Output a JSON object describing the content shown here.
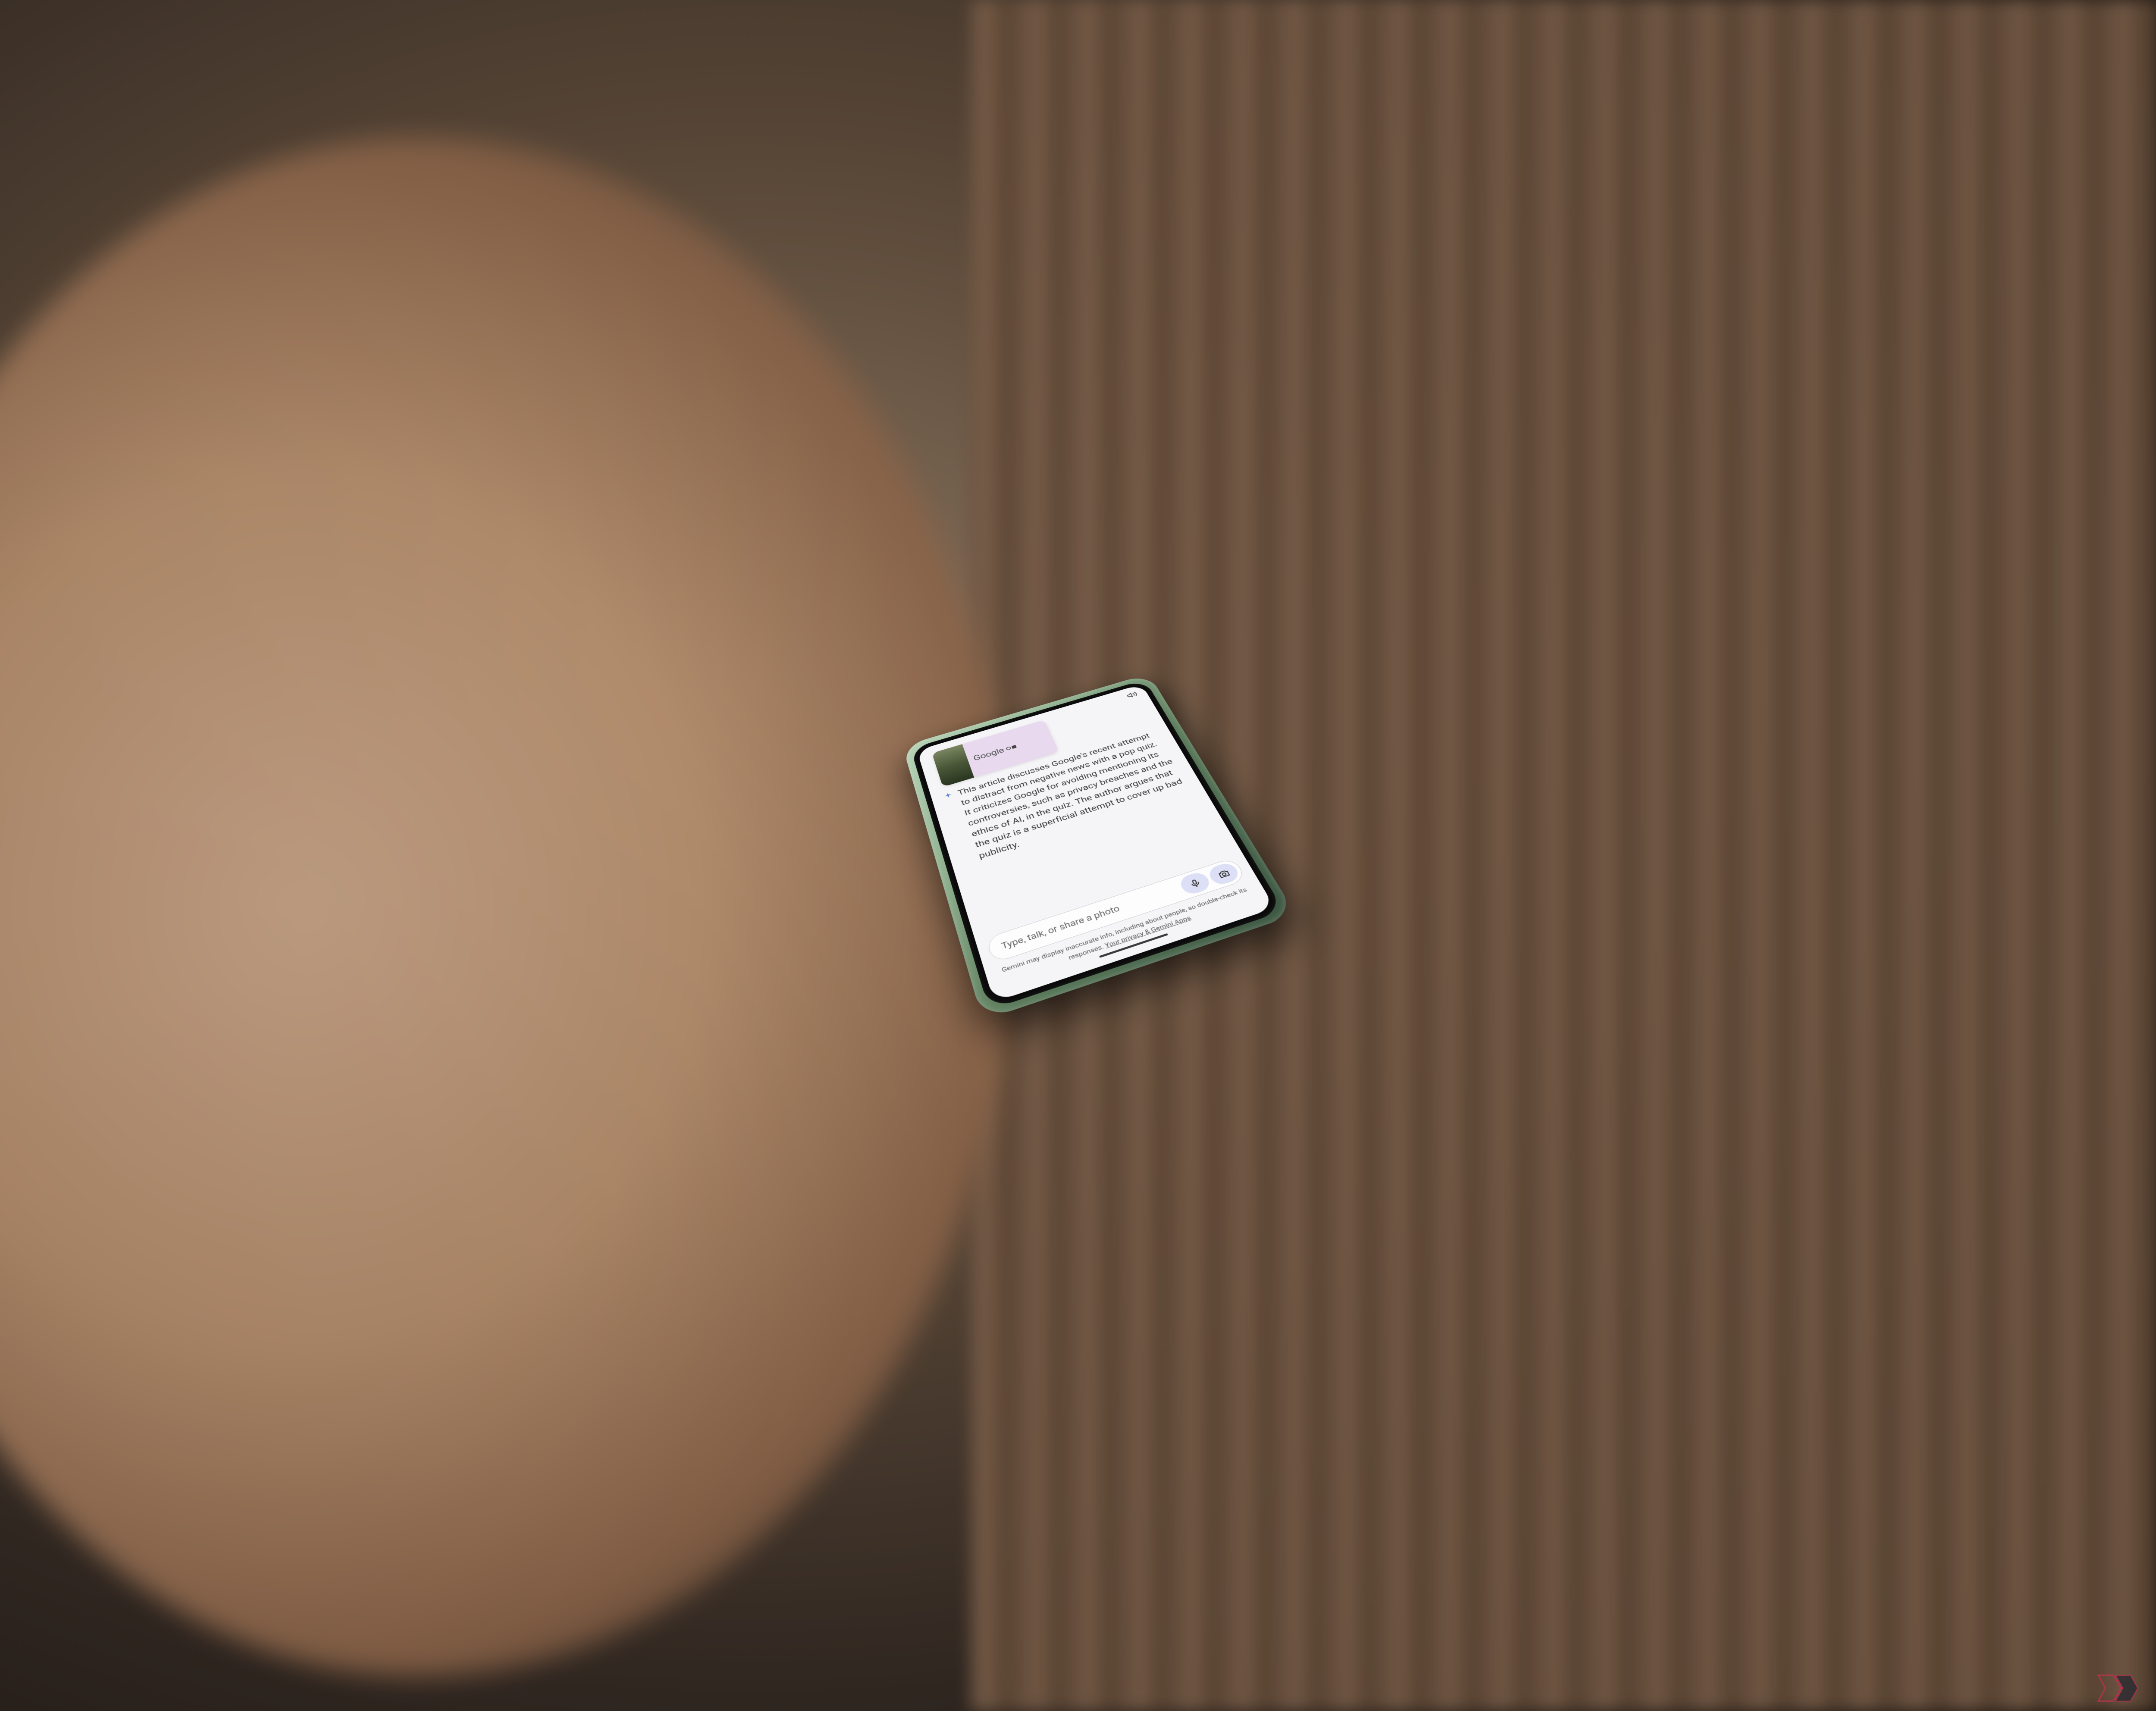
{
  "card": {
    "logo_text": "Google"
  },
  "response": {
    "text": "This article discusses Google's recent attempt to distract from negative news with a pop quiz. It criticizes Google for avoiding mentioning its controversies, such as privacy breaches and the ethics of AI, in the quiz. The author argues that the quiz is a superficial attempt to cover up bad publicity."
  },
  "input": {
    "placeholder": "Type, talk, or share a photo"
  },
  "disclaimer": {
    "text": "Gemini may display inaccurate info, including about people, so double-check its responses. ",
    "link": "Your privacy & Gemini Apps"
  }
}
